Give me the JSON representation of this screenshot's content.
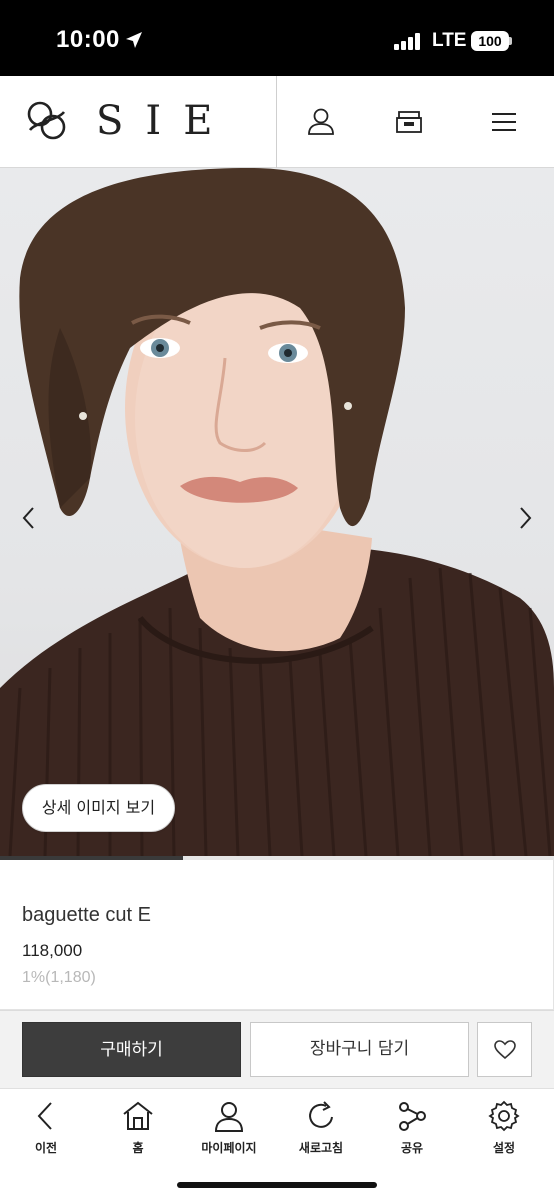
{
  "status_bar": {
    "time": "10:00",
    "network": "LTE",
    "battery": "100"
  },
  "header": {
    "brand": "SIE",
    "icons": [
      "user-icon",
      "shop-icon",
      "menu-icon"
    ]
  },
  "gallery": {
    "detail_button": "상세 이미지 보기",
    "progress": 0.33
  },
  "product": {
    "name": "baguette cut E",
    "price": "118,000",
    "point": "1%(1,180)"
  },
  "actions": {
    "buy": "구매하기",
    "cart": "장바구니 담기"
  },
  "bottom_nav": {
    "items": [
      {
        "label": "이전",
        "icon": "back-icon"
      },
      {
        "label": "홈",
        "icon": "home-icon"
      },
      {
        "label": "마이페이지",
        "icon": "mypage-icon"
      },
      {
        "label": "새로고침",
        "icon": "refresh-icon"
      },
      {
        "label": "공유",
        "icon": "share-icon"
      },
      {
        "label": "설정",
        "icon": "settings-icon"
      }
    ]
  },
  "colors": {
    "buy_button": "#3d3d3d",
    "shirt": "#3b2620",
    "hair": "#4a3426"
  }
}
